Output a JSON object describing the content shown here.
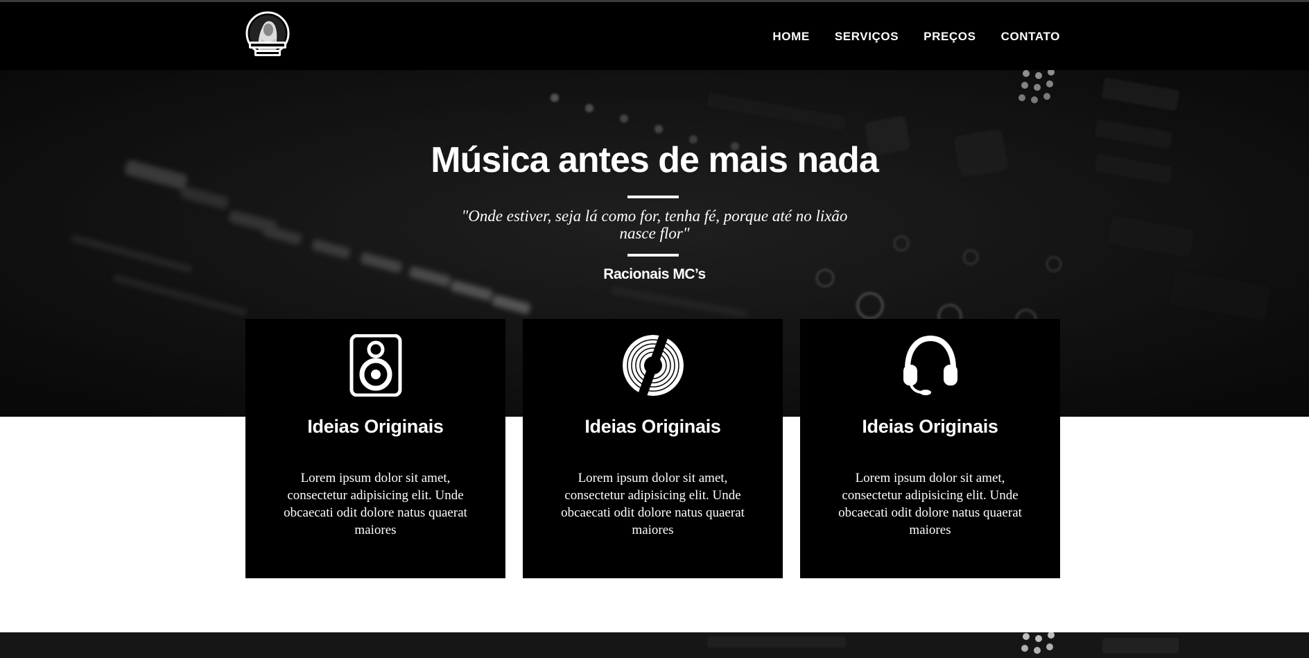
{
  "nav": {
    "logo": "gaita-records-logo",
    "links": [
      "HOME",
      "SERVIÇOS",
      "PREÇOS",
      "CONTATO"
    ]
  },
  "hero": {
    "title": "Música antes de mais nada",
    "quote": "\"Onde estiver, seja lá como for, tenha fé, porque até no lixão nasce flor\"",
    "author": "Racionais MC’s"
  },
  "cards": [
    {
      "icon": "speaker-icon",
      "title": "Ideias Originais",
      "text": "Lorem ipsum dolor sit amet, consectetur adipisicing elit. Unde obcaecati odit dolore natus quaerat maiores"
    },
    {
      "icon": "vinyl-record-icon",
      "title": "Ideias Originais",
      "text": "Lorem ipsum dolor sit amet, consectetur adipisicing elit. Unde obcaecati odit dolore natus quaerat maiores"
    },
    {
      "icon": "headphones-icon",
      "title": "Ideias Originais",
      "text": "Lorem ipsum dolor sit amet, consectetur adipisicing elit. Unde obcaecati odit dolore natus quaerat maiores"
    }
  ],
  "colors": {
    "background": "#000000",
    "text": "#ffffff",
    "page": "#ffffff"
  }
}
